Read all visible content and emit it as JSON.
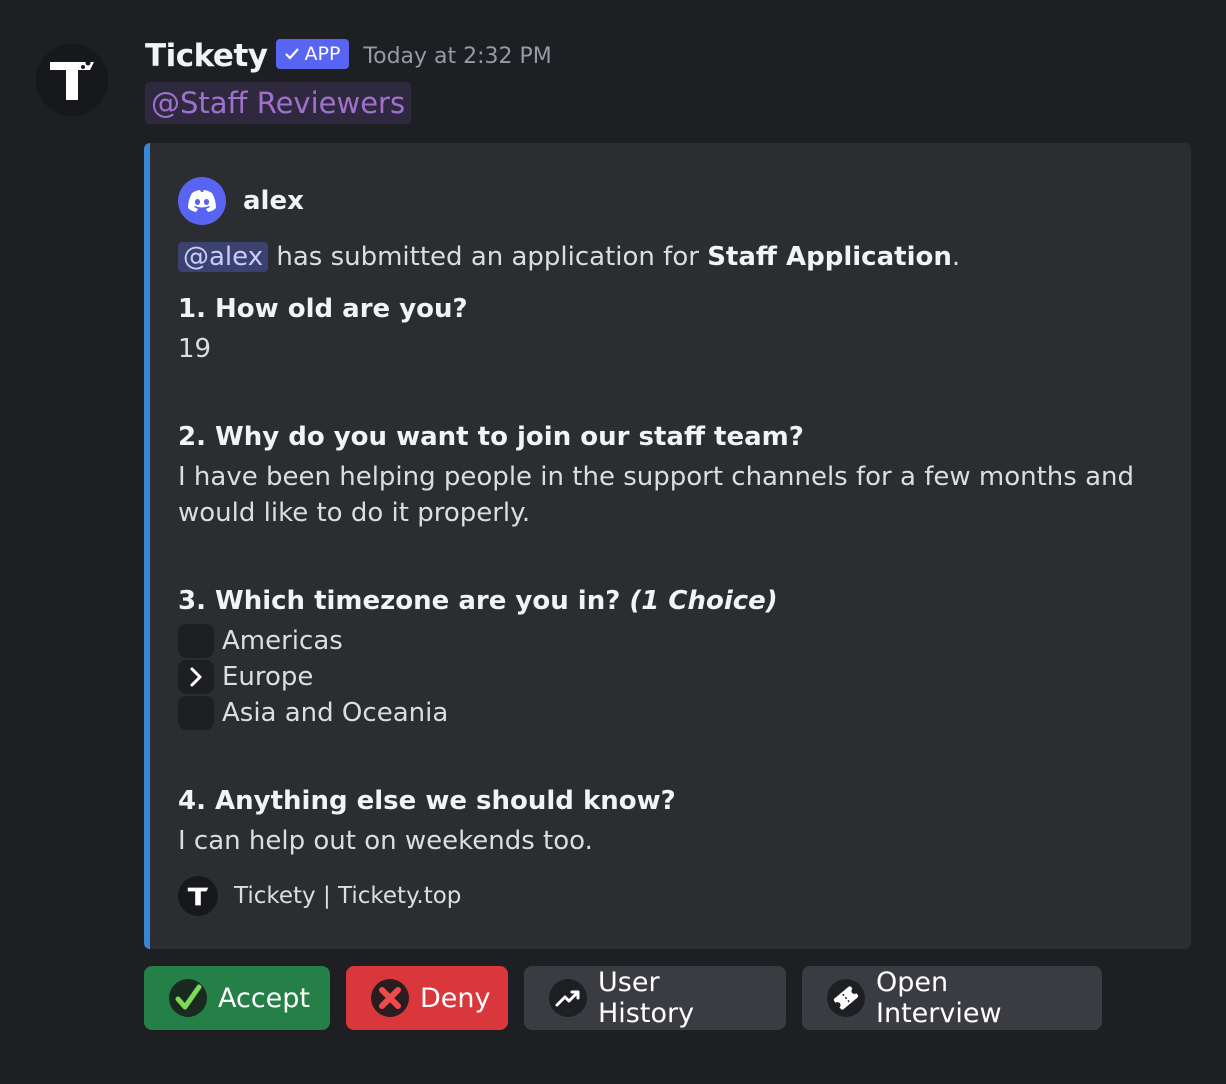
{
  "message": {
    "author": "Tickety",
    "badge": "APP",
    "timestamp": "Today at 2:32 PM",
    "role_mention": "@Staff Reviewers"
  },
  "embed": {
    "accent_color": "#3b85d6",
    "author_name": "alex",
    "description": {
      "mention": "@alex",
      "text_before": "has submitted an application for",
      "bold": "Staff Application",
      "text_after": "."
    },
    "questions": [
      {
        "title": "1. How old are you?",
        "answer": "19"
      },
      {
        "title": "2. Why do you want to join our staff team?",
        "answer": "I have been helping people in the support channels for a few months and would like to do it properly."
      },
      {
        "title": "3. Which timezone are you in?",
        "title_suffix": "(1 Choice)",
        "choices": [
          {
            "label": "Americas",
            "selected": false
          },
          {
            "label": "Europe",
            "selected": true
          },
          {
            "label": "Asia and Oceania",
            "selected": false
          }
        ]
      },
      {
        "title": "4. Anything else we should know?",
        "answer": "I can help out on weekends too."
      }
    ],
    "footer": "Tickety | Tickety.top"
  },
  "buttons": {
    "accept": "Accept",
    "deny": "Deny",
    "user_history": "User History",
    "open_interview": "Open Interview"
  }
}
